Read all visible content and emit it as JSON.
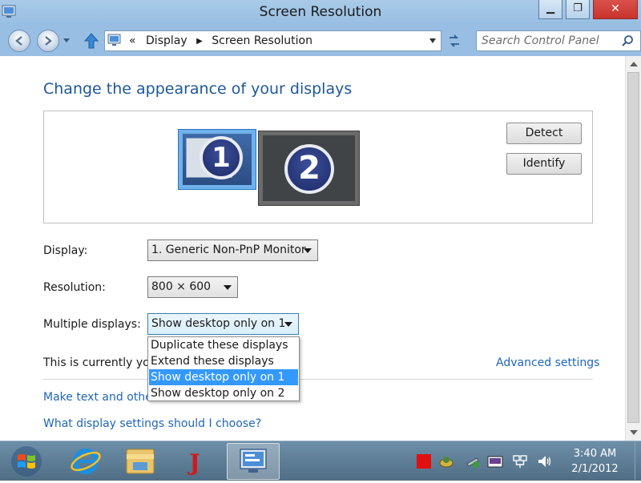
{
  "window": {
    "title": "Screen Resolution",
    "controls": {
      "minimize": "▁",
      "maximize": "❐",
      "close": "✕"
    }
  },
  "address_bar": {
    "chevron": "«",
    "breadcrumb": [
      "Display",
      "Screen Resolution"
    ],
    "separator": "▶",
    "search_placeholder": "Search Control Panel"
  },
  "content": {
    "heading": "Change the appearance of your displays",
    "monitors": [
      {
        "number": "1",
        "selected": true
      },
      {
        "number": "2",
        "selected": false
      }
    ],
    "buttons": {
      "detect": "Detect",
      "identify": "Identify"
    },
    "display": {
      "label": "Display:",
      "value": "1. Generic Non-PnP Monitor"
    },
    "resolution": {
      "label": "Resolution:",
      "value": "800 × 600"
    },
    "multiple_displays": {
      "label": "Multiple displays:",
      "value": "Show desktop only on 1",
      "options": [
        "Duplicate these displays",
        "Extend these displays",
        "Show desktop only on 1",
        "Show desktop only on 2"
      ],
      "selected_index": 2
    },
    "status_text": "This is currently you",
    "advanced_link": "Advanced settings",
    "text_size_link": "Make text and other",
    "help_link": "What display settings should I choose?"
  },
  "taskbar": {
    "time": "3:40 AM",
    "date": "2/1/2012",
    "j_app_letter": "J"
  },
  "colors": {
    "titlebar": "#a9cbe8",
    "link": "#1e66b8",
    "heading": "#1e5799",
    "selection": "#3399ff",
    "taskbar": "#5c7c94"
  },
  "icons": [
    "control-panel-icon",
    "back-arrow-icon",
    "forward-arrow-icon",
    "up-arrow-icon",
    "refresh-icon",
    "search-icon",
    "windows-logo-icon",
    "internet-explorer-icon",
    "file-explorer-icon",
    "control-panel-taskbar-icon",
    "stop-icon",
    "network-icon",
    "volume-icon",
    "action-center-icon",
    "keyboard-icon",
    "power-icon"
  ]
}
